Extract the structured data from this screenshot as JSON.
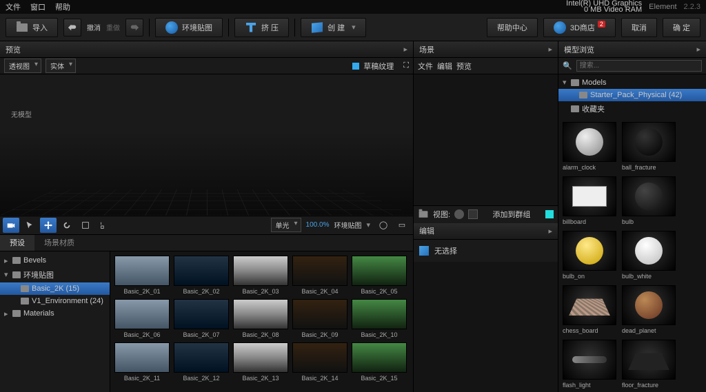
{
  "menu": {
    "file": "文件",
    "window": "窗口",
    "help": "帮助"
  },
  "gpu": {
    "line1": "Intel(R) UHD Graphics",
    "line2": "0 MB Video RAM"
  },
  "app": {
    "name": "Element",
    "version": "2.2.3"
  },
  "tool": {
    "import": "导入",
    "undo": "撤消",
    "redo": "重做",
    "env": "环境贴图",
    "extrude": "挤 压",
    "create": "创 建",
    "helpcenter": "帮助中心",
    "store": "3D商店",
    "storebadge": "2",
    "cancel": "取消",
    "ok": "确 定"
  },
  "preview": {
    "title": "预览",
    "viewdd": "透视图",
    "soliddd": "实体",
    "grass": "草稿纹理",
    "droplabel": "无模型"
  },
  "tb2": {
    "dd": "单光",
    "zoom": "100.0%",
    "label": "环境贴图"
  },
  "tabs": {
    "preset": "预设",
    "mat": "场景材质"
  },
  "tree": [
    {
      "label": "Bevels",
      "lv": 0,
      "tri": "▸",
      "sel": false
    },
    {
      "label": "环境贴图",
      "lv": 0,
      "tri": "▾",
      "sel": false
    },
    {
      "label": "Basic_2K (15)",
      "lv": 1,
      "tri": "",
      "sel": true
    },
    {
      "label": "V1_Environment (24)",
      "lv": 1,
      "tri": "",
      "sel": false
    },
    {
      "label": "Materials",
      "lv": 0,
      "tri": "▸",
      "sel": false
    }
  ],
  "thumbs": [
    "Basic_2K_01",
    "Basic_2K_02",
    "Basic_2K_03",
    "Basic_2K_04",
    "Basic_2K_05",
    "Basic_2K_06",
    "Basic_2K_07",
    "Basic_2K_08",
    "Basic_2K_09",
    "Basic_2K_10",
    "Basic_2K_11",
    "Basic_2K_12",
    "Basic_2K_13",
    "Basic_2K_14",
    "Basic_2K_15"
  ],
  "scene": {
    "title": "场景",
    "file": "文件",
    "edit": "编辑",
    "preview": "预览",
    "view": "视图:",
    "addgroup": "添加到群组"
  },
  "edit": {
    "title": "编辑",
    "nosel": "无选择"
  },
  "mb": {
    "title": "模型浏览",
    "search": "搜索..."
  },
  "mtree": [
    {
      "label": "Models",
      "lv": 0,
      "tri": "▾",
      "sel": false
    },
    {
      "label": "Starter_Pack_Physical (42)",
      "lv": 1,
      "tri": "",
      "sel": true
    },
    {
      "label": "收藏夹",
      "lv": 0,
      "tri": "",
      "sel": false
    }
  ],
  "models": [
    "alarm_clock",
    "ball_fracture",
    "billboard",
    "bulb",
    "bulb_on",
    "bulb_white",
    "chess_board",
    "dead_planet",
    "flash_light",
    "floor_fracture"
  ]
}
